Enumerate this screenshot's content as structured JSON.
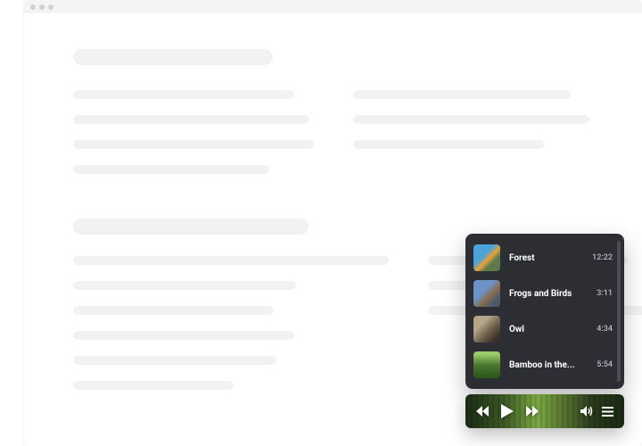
{
  "playlist": {
    "tracks": [
      {
        "title": "Forest",
        "duration": "12:22",
        "art": "art-forest"
      },
      {
        "title": "Frogs and Birds",
        "duration": "3:11",
        "art": "art-frogs"
      },
      {
        "title": "Owl",
        "duration": "4:34",
        "art": "art-owl"
      },
      {
        "title": "Bamboo in the...",
        "duration": "5:54",
        "art": "art-bamboo"
      }
    ]
  },
  "skeleton": {
    "group1": {
      "left": [
        248,
        265,
        270,
        220
      ],
      "right": [
        244,
        265,
        214
      ]
    },
    "group2": {
      "title_w": 264,
      "left": [
        354,
        250,
        225,
        248,
        228,
        180
      ],
      "right": [
        224,
        160,
        244
      ]
    }
  }
}
